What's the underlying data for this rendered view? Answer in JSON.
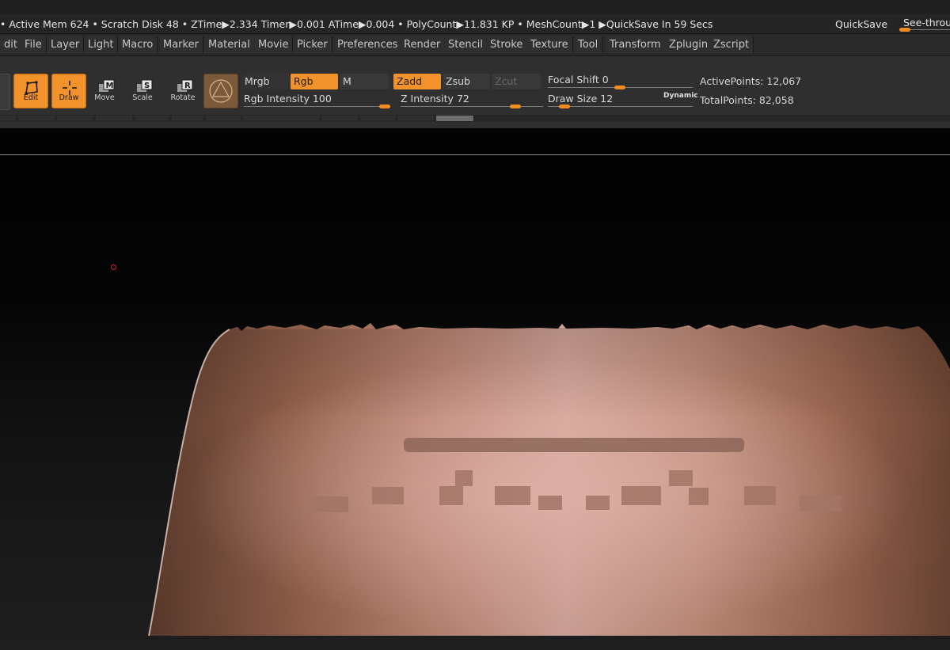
{
  "status": {
    "line": "• Active Mem 624 • Scratch Disk 48 •  ZTime▶2.334 Timer▶0.001 ATime▶0.004 • PolyCount▶11.831 KP  • MeshCount▶1  ▶QuickSave In 59 Secs",
    "quicksave_label": "QuickSave",
    "see_through_label": "See-through"
  },
  "menu": [
    "dit",
    "File",
    "Layer",
    "Light",
    "Macro",
    "Marker",
    "Material",
    "Movie",
    "Picker",
    "Preferences",
    "Render",
    "Stencil",
    "Stroke",
    "Texture",
    "Tool",
    "Transform",
    "Zplugin",
    "Zscript"
  ],
  "tools": {
    "edit": "Edit",
    "draw": "Draw",
    "move": "Move",
    "scale": "Scale",
    "rotate": "Rotate",
    "move_key": "M",
    "scale_key": "S",
    "rotate_key": "R"
  },
  "modes": {
    "mrgb": "Mrgb",
    "rgb": "Rgb",
    "m": "M",
    "zadd": "Zadd",
    "zsub": "Zsub",
    "zcut": "Zcut"
  },
  "sliders": {
    "rgb_intensity_label": "Rgb Intensity",
    "rgb_intensity": 100,
    "z_intensity_label": "Z Intensity",
    "z_intensity": 72,
    "focal_shift_label": "Focal Shift",
    "focal_shift": 0,
    "draw_size_label": "Draw Size",
    "draw_size": 12,
    "dynamic_label": "Dynamic"
  },
  "stats": {
    "active_points": "ActivePoints: 12,067",
    "total_points": "TotalPoints: 82,058"
  },
  "colors": {
    "accent": "#f2922b",
    "skin_light": "#d9aaa1",
    "skin_dark": "#7a4d3a"
  }
}
